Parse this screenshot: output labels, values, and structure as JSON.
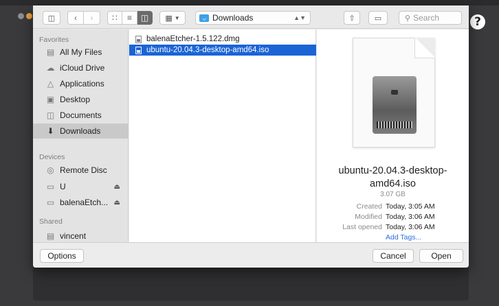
{
  "toolbar": {
    "path_label": "Downloads",
    "search_placeholder": "Search"
  },
  "sidebar": {
    "favorites_header": "Favorites",
    "favorites": [
      {
        "label": "All My Files",
        "icon": "all-files-icon"
      },
      {
        "label": "iCloud Drive",
        "icon": "cloud-icon"
      },
      {
        "label": "Applications",
        "icon": "applications-icon"
      },
      {
        "label": "Desktop",
        "icon": "desktop-icon"
      },
      {
        "label": "Documents",
        "icon": "documents-icon"
      },
      {
        "label": "Downloads",
        "icon": "downloads-icon"
      }
    ],
    "devices_header": "Devices",
    "devices": [
      {
        "label": "Remote Disc",
        "icon": "disc-icon"
      },
      {
        "label": "U",
        "icon": "drive-icon"
      },
      {
        "label": "balenaEtch...",
        "icon": "drive-icon"
      }
    ],
    "shared_header": "Shared",
    "shared": [
      {
        "label": "vincent",
        "icon": "computer-icon"
      }
    ]
  },
  "files": [
    {
      "name": "balenaEtcher-1.5.122.dmg"
    },
    {
      "name": "ubuntu-20.04.3-desktop-amd64.iso"
    }
  ],
  "preview": {
    "name_line1": "ubuntu-20.04.3-desktop-",
    "name_line2": "amd64.iso",
    "size": "3.07 GB",
    "created_label": "Created",
    "created_value": "Today, 3:05 AM",
    "modified_label": "Modified",
    "modified_value": "Today, 3:06 AM",
    "last_opened_label": "Last opened",
    "last_opened_value": "Today, 3:06 AM",
    "add_tags": "Add Tags..."
  },
  "buttons": {
    "options": "Options",
    "cancel": "Cancel",
    "open": "Open"
  },
  "help": "?"
}
